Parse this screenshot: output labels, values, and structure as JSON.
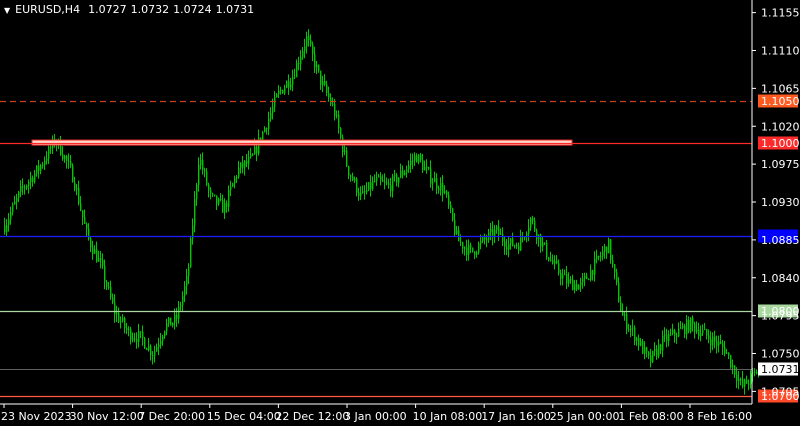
{
  "header": {
    "title": "EURUSD,H4",
    "ohlc": [
      "1.0727",
      "1.0732",
      "1.0724",
      "1.0731"
    ]
  },
  "colors": {
    "background": "#000000",
    "axis": "#ffffff",
    "candle": "#00c800",
    "label_text": "#ffffff"
  },
  "chart_data": {
    "type": "candlestick",
    "symbol": "EURUSD",
    "timeframe": "H4",
    "ylim": [
      1.069,
      1.117
    ],
    "yticks": [
      "1.1155",
      "1.1110",
      "1.1065",
      "1.1020",
      "1.0975",
      "1.0930",
      "1.0885",
      "1.0840",
      "1.0795",
      "1.0750",
      "1.0705"
    ],
    "xticks": [
      "23 Nov 2023",
      "30 Nov 12:00",
      "7 Dec 20:00",
      "15 Dec 04:00",
      "22 Dec 12:00",
      "3 Jan 00:00",
      "10 Jan 08:00",
      "17 Jan 16:00",
      "25 Jan 00:00",
      "1 Feb 08:00",
      "8 Feb 16:00"
    ],
    "close_path": [
      [
        "23 Nov 2023",
        1.0902
      ],
      [
        "26 Nov",
        1.0945
      ],
      [
        "28 Nov",
        1.097
      ],
      [
        "29 Nov",
        1.1005
      ],
      [
        "30 Nov 12:00",
        1.096
      ],
      [
        "1 Dec",
        1.089
      ],
      [
        "4 Dec",
        1.0855
      ],
      [
        "5 Dec",
        1.08
      ],
      [
        "6 Dec",
        1.0775
      ],
      [
        "7 Dec 20:00",
        1.0768
      ],
      [
        "8 Dec",
        1.075
      ],
      [
        "11 Dec",
        1.0782
      ],
      [
        "12 Dec",
        1.079
      ],
      [
        "13 Dec",
        1.084
      ],
      [
        "14 Dec",
        1.0985
      ],
      [
        "15 Dec 04:00",
        1.0935
      ],
      [
        "18 Dec",
        1.0922
      ],
      [
        "19 Dec",
        1.0968
      ],
      [
        "20 Dec",
        1.098
      ],
      [
        "21 Dec",
        1.102
      ],
      [
        "22 Dec 12:00",
        1.106
      ],
      [
        "26 Dec",
        1.108
      ],
      [
        "27 Dec",
        1.1125
      ],
      [
        "28 Dec",
        1.1075
      ],
      [
        "29 Dec",
        1.104
      ],
      [
        "3 Jan 00:00",
        1.097
      ],
      [
        "4 Jan",
        1.0935
      ],
      [
        "5 Jan",
        1.0955
      ],
      [
        "8 Jan",
        1.0948
      ],
      [
        "9 Jan",
        1.0965
      ],
      [
        "10 Jan 08:00",
        1.0985
      ],
      [
        "11 Jan",
        1.096
      ],
      [
        "12 Jan",
        1.0945
      ],
      [
        "15 Jan",
        1.0885
      ],
      [
        "16 Jan",
        1.087
      ],
      [
        "17 Jan 16:00",
        1.0885
      ],
      [
        "18 Jan",
        1.0895
      ],
      [
        "19 Jan",
        1.088
      ],
      [
        "22 Jan",
        1.088
      ],
      [
        "23 Jan",
        1.091
      ],
      [
        "24 Jan",
        1.088
      ],
      [
        "25 Jan 00:00",
        1.0855
      ],
      [
        "26 Jan",
        1.0835
      ],
      [
        "29 Jan",
        1.083
      ],
      [
        "30 Jan",
        1.0855
      ],
      [
        "31 Jan",
        1.088
      ],
      [
        "1 Feb 08:00",
        1.0795
      ],
      [
        "2 Feb",
        1.077
      ],
      [
        "5 Feb",
        1.074
      ],
      [
        "6 Feb",
        1.0765
      ],
      [
        "7 Feb",
        1.0775
      ],
      [
        "8 Feb 16:00",
        1.0785
      ],
      [
        "9 Feb",
        1.077
      ],
      [
        "12 Feb",
        1.0755
      ],
      [
        "13 Feb",
        1.071
      ],
      [
        "14 Feb",
        1.0731
      ]
    ],
    "last_price": "1.0731",
    "horizontal_levels": [
      {
        "price": 1.105,
        "label": "1.1050",
        "color": "#c8401a",
        "style": "dashed",
        "label_bg": "#ff5a1f"
      },
      {
        "price": 1.1,
        "label": "1.1000",
        "color": "#ff2a2a",
        "style": "solid",
        "label_bg": "#ff2a2a"
      },
      {
        "price": 1.089,
        "label": "",
        "color": "#1c1cff",
        "style": "solid",
        "label_bg": "#0000ff"
      },
      {
        "price": 1.08,
        "label": "1.0800",
        "color": "#a8d8a0",
        "style": "solid",
        "label_bg": "#a8d8a0"
      },
      {
        "price": 1.0731,
        "label": "1.0731",
        "color": "#808080",
        "style": "thin",
        "label_bg": "#ffffff",
        "label_color": "#000000"
      },
      {
        "price": 1.07,
        "label": "1.0700",
        "color": "#ff5a3c",
        "style": "solid",
        "label_bg": "#ff4a2a"
      }
    ],
    "zone": {
      "price": 1.1,
      "from": "23 Nov 2023",
      "to": "3 Jan 00:00",
      "color": "#ffd8cc"
    },
    "grid": false
  }
}
